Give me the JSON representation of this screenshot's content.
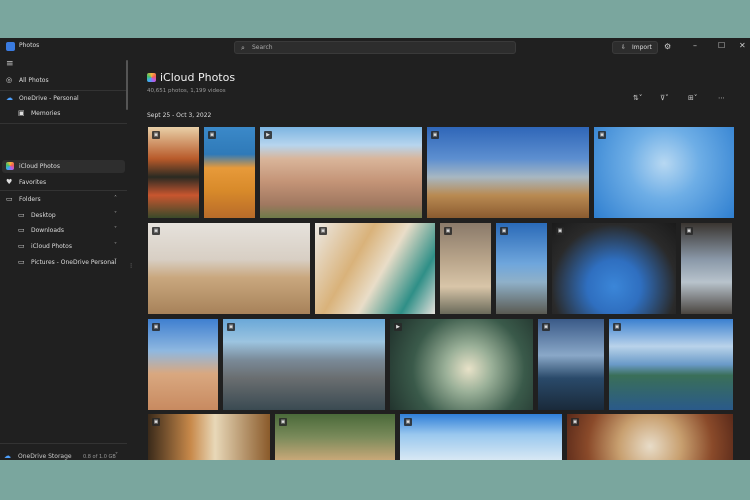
{
  "window": {
    "title": "Photos"
  },
  "search": {
    "placeholder": "Search"
  },
  "toolbar": {
    "import_label": "Import"
  },
  "sidebar": {
    "items": [
      {
        "label": "All Photos"
      },
      {
        "label": "OneDrive - Personal"
      },
      {
        "label": "Memories"
      },
      {
        "label": "iCloud Photos"
      },
      {
        "label": "Favorites"
      },
      {
        "label": "Folders"
      },
      {
        "label": "Desktop"
      },
      {
        "label": "Downloads"
      },
      {
        "label": "iCloud Photos"
      },
      {
        "label": "Pictures - OneDrive Personal"
      }
    ],
    "storage": {
      "label": "OneDrive Storage",
      "usage": "0.8 of 1.0 GB",
      "fraction": 0.15
    }
  },
  "main": {
    "title": "iCloud Photos",
    "subtitle": "40,651 photos, 1,199 videos",
    "date_range": "Sept 25 - Oct 3, 2022"
  },
  "icons": {
    "app": "photos-app-icon",
    "search": "search-icon",
    "import": "import-icon",
    "settings": "gear-icon",
    "sort": "sort-icon",
    "filter": "filter-icon",
    "view": "grid-view-icon",
    "more": "more-icon"
  },
  "colors": {
    "accent": "#4ea1ff",
    "window_bg": "#202020",
    "desktop_bg": "#7aa69e"
  }
}
